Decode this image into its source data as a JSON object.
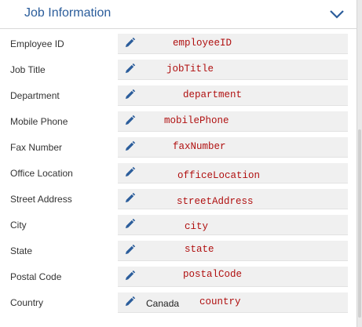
{
  "header": {
    "title": "Job Information",
    "collapse_icon": "chevron-down-icon"
  },
  "fields": [
    {
      "label": "Employee ID",
      "value": "",
      "binding": "employeeID"
    },
    {
      "label": "Job Title",
      "value": "",
      "binding": "jobTitle"
    },
    {
      "label": "Department",
      "value": "",
      "binding": "department"
    },
    {
      "label": "Mobile Phone",
      "value": "",
      "binding": "mobilePhone"
    },
    {
      "label": "Fax Number",
      "value": "",
      "binding": "faxNumber"
    },
    {
      "label": "Office Location",
      "value": "",
      "binding": "officeLocation"
    },
    {
      "label": "Street Address",
      "value": "",
      "binding": "streetAddress"
    },
    {
      "label": "City",
      "value": "",
      "binding": "city"
    },
    {
      "label": "State",
      "value": "",
      "binding": "state"
    },
    {
      "label": "Postal Code",
      "value": "",
      "binding": "postalCode"
    },
    {
      "label": "Country",
      "value": "Canada",
      "binding": "country"
    }
  ],
  "colors": {
    "accent": "#2b5d9b",
    "binding_text": "#b01010",
    "field_bg": "#f0f0f0"
  }
}
